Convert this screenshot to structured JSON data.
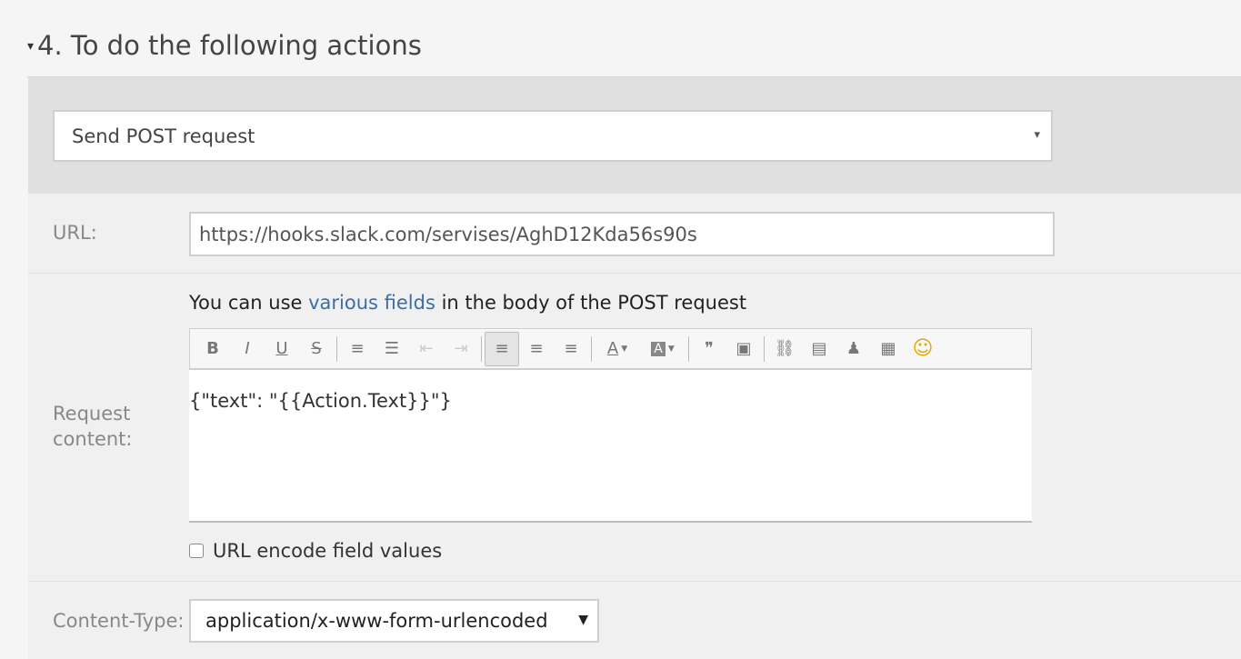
{
  "section": {
    "caret": "▾",
    "title": "4. To do the following actions"
  },
  "action": {
    "selected": "Send POST request",
    "arrow": "▾"
  },
  "url": {
    "label": "URL:",
    "value": "https://hooks.slack.com/servises/AghD12Kda56s90s"
  },
  "request": {
    "label": "Request content:",
    "hint_before": "You can use ",
    "hint_link": "various fields",
    "hint_after": " in the body of the POST request",
    "body": "{\"text\": \"{{Action.Text}}\"}",
    "toolbar": [
      {
        "name": "bold-icon",
        "glyph": "B"
      },
      {
        "name": "italic-icon",
        "glyph": "I"
      },
      {
        "name": "underline-icon",
        "glyph": "U"
      },
      {
        "name": "strikethrough-icon",
        "glyph": "S"
      },
      {
        "name": "ordered-list-icon",
        "glyph": "≡"
      },
      {
        "name": "unordered-list-icon",
        "glyph": "☰"
      },
      {
        "name": "outdent-icon",
        "glyph": "⇤"
      },
      {
        "name": "indent-icon",
        "glyph": "⇥"
      },
      {
        "name": "align-left-icon",
        "glyph": "≡"
      },
      {
        "name": "align-center-icon",
        "glyph": "≡"
      },
      {
        "name": "align-right-icon",
        "glyph": "≡"
      },
      {
        "name": "text-color-icon",
        "glyph": "A"
      },
      {
        "name": "background-color-icon",
        "glyph": "A"
      },
      {
        "name": "blockquote-icon",
        "glyph": "❞"
      },
      {
        "name": "paste-text-icon",
        "glyph": "▣"
      },
      {
        "name": "link-icon",
        "glyph": "⛓"
      },
      {
        "name": "template-icon",
        "glyph": "▤"
      },
      {
        "name": "user-icon",
        "glyph": "♟"
      },
      {
        "name": "table-icon",
        "glyph": "▦"
      },
      {
        "name": "emoji-icon",
        "glyph": "☺"
      }
    ]
  },
  "url_encode": {
    "label": "URL encode field values",
    "checked": false
  },
  "content_type": {
    "label": "Content-Type:",
    "selected": "application/x-www-form-urlencoded",
    "arrow": "▼"
  }
}
